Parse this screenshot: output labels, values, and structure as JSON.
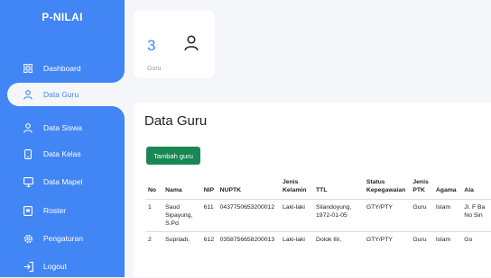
{
  "sidebar": {
    "brand": "P-NILAI",
    "items": [
      {
        "label": "Dashboard",
        "icon": "grid-icon"
      },
      {
        "label": "Data Guru",
        "icon": "user-icon",
        "active": true
      },
      {
        "label": "Data Siswa",
        "icon": "user-icon"
      },
      {
        "label": "Data Kelas",
        "icon": "phone-icon"
      },
      {
        "label": "Data Mapel",
        "icon": "monitor-icon"
      },
      {
        "label": "Roster",
        "icon": "tablet-icon"
      },
      {
        "label": "Pengaturan",
        "icon": "gear-icon"
      },
      {
        "label": "Logout",
        "icon": "logout-icon"
      }
    ]
  },
  "stat_card": {
    "value": "3",
    "label": "Guru",
    "icon": "user-icon"
  },
  "main": {
    "title": "Data Guru",
    "add_button": "Tambah guru",
    "table": {
      "headers": [
        "No",
        "Nama",
        "NIP",
        "NUPTK",
        "Jenis Kelamin",
        "TTL",
        "Status Kepegawaian",
        "Jenis PTK",
        "Agama",
        "Ala"
      ],
      "rows": [
        [
          "1",
          "Saud Sipayung, S.Pd",
          "611",
          "0437750653200012",
          "Laki-laki",
          "Silandoyung, 1972-01-05",
          "GTY/PTY",
          "Guru",
          "Islam",
          "Jl. F Ba No Sin"
        ],
        [
          "2",
          "Supriadi,",
          "612",
          "0358756658200013",
          "Laki-laki",
          "Dolok Ilir,",
          "GTY/PTY",
          "Guru",
          "Islam",
          "Go"
        ]
      ]
    }
  },
  "colors": {
    "primary": "#4285f4",
    "button": "#198754",
    "background": "#f4f6f9"
  }
}
